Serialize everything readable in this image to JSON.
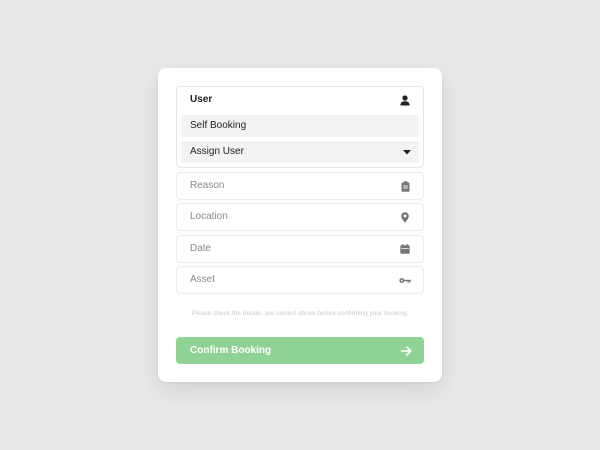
{
  "user_select": {
    "label": "User",
    "icon": "person-icon",
    "options": [
      {
        "label": "Self Booking"
      },
      {
        "label": "Assign User",
        "icon": "caret-down-icon"
      }
    ]
  },
  "fields": {
    "reason": {
      "placeholder": "Reason",
      "icon": "clipboard-icon"
    },
    "location": {
      "placeholder": "Location",
      "icon": "map-pin-icon"
    },
    "date": {
      "placeholder": "Date",
      "icon": "calendar-icon"
    },
    "asset": {
      "placeholder": "Asset",
      "icon": "key-icon"
    }
  },
  "note": "Please check the details, are correct above before confirming your booking.",
  "confirm_button": {
    "label": "Confirm Booking",
    "icon": "arrow-right-icon",
    "color": "#8fd394"
  }
}
